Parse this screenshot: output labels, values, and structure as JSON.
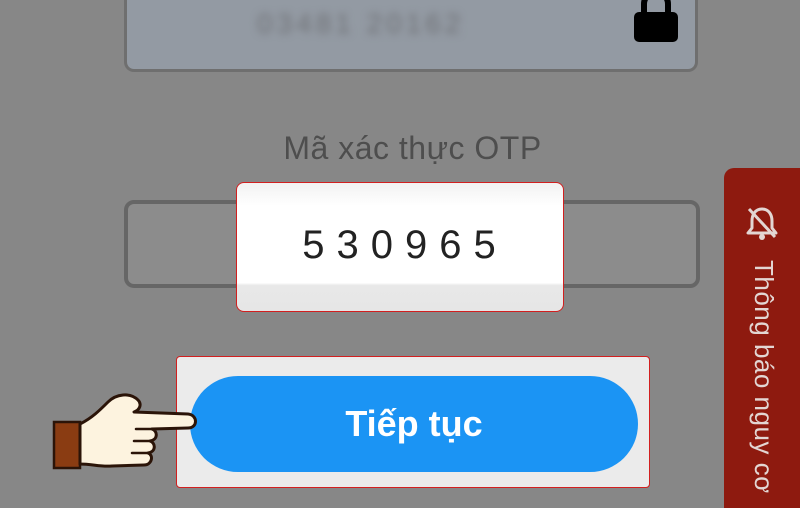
{
  "phone_field": {
    "masked_value": "03481 20162",
    "icon": "lock-icon"
  },
  "otp": {
    "label": "Mã xác thực OTP",
    "value": "530965"
  },
  "continue_button": {
    "label": "Tiếp tục"
  },
  "side_tab": {
    "label": "Thông báo nguy cơ",
    "icon": "bell-icon"
  },
  "pointer": {
    "icon": "pointing-hand-icon"
  },
  "colors": {
    "button": "#1b94f4",
    "highlight_border": "#d21f1f",
    "side_tab": "#8e1a0f",
    "overlay": "#878787"
  }
}
